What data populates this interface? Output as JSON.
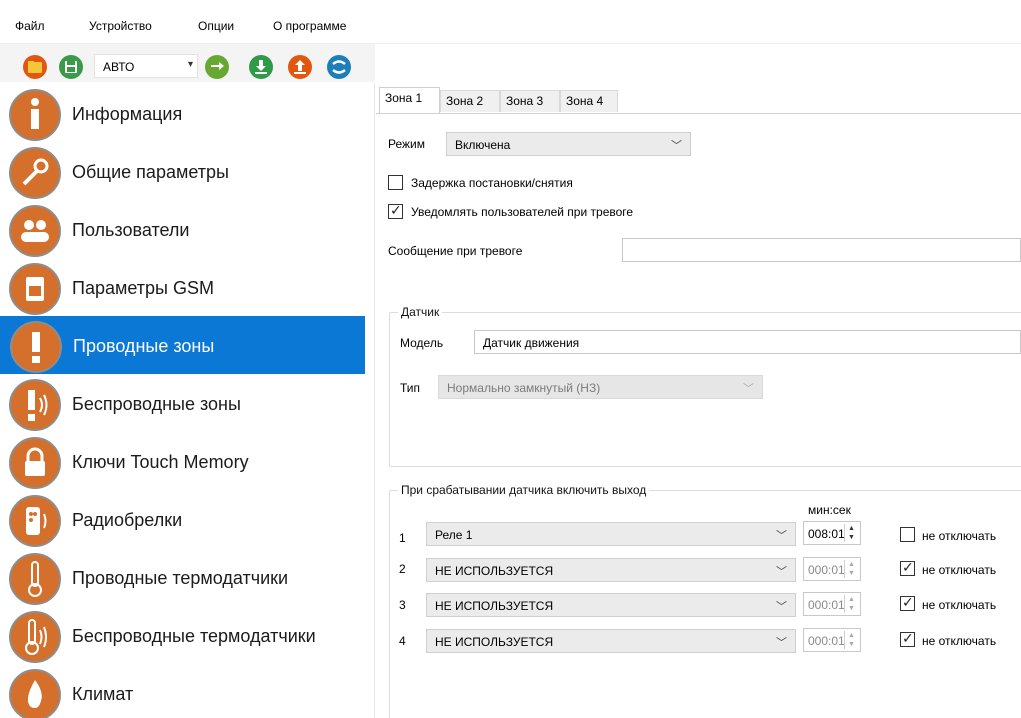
{
  "menu": [
    "Файл",
    "Устройство",
    "Опции",
    "О программе"
  ],
  "toolbar": {
    "mode_value": "АВТО",
    "icons": [
      "open-folder-icon",
      "save-icon",
      "refresh-icon",
      "download-icon",
      "upload-icon",
      "connect-icon"
    ]
  },
  "sidebar": {
    "items": [
      {
        "label": "Информация",
        "icon": "info-icon"
      },
      {
        "label": "Общие параметры",
        "icon": "wrench-icon"
      },
      {
        "label": "Пользователи",
        "icon": "users-icon"
      },
      {
        "label": "Параметры GSM",
        "icon": "sim-card-icon"
      },
      {
        "label": "Проводные зоны",
        "icon": "exclamation-icon"
      },
      {
        "label": "Беспроводные зоны",
        "icon": "wireless-exclamation-icon"
      },
      {
        "label": "Ключи Touch Memory",
        "icon": "lock-icon"
      },
      {
        "label": "Радиобрелки",
        "icon": "keyfob-icon"
      },
      {
        "label": "Проводные термодатчики",
        "icon": "thermometer-icon"
      },
      {
        "label": "Беспроводные термодатчики",
        "icon": "wireless-thermometer-icon"
      },
      {
        "label": "Климат",
        "icon": "flame-icon"
      }
    ],
    "active_index": 4,
    "active_color": "#0a78d4"
  },
  "tabs": [
    "Зона 1",
    "Зона 2",
    "Зона 3",
    "Зона 4"
  ],
  "zone": {
    "mode_label": "Режим",
    "mode_value": "Включена",
    "delay_label": "Задержка постановки/снятия",
    "delay_checked": false,
    "notify_label": "Уведомлять пользователей при тревоге",
    "notify_checked": true,
    "alarm_msg_label": "Сообщение при тревоге",
    "alarm_msg_value": ""
  },
  "sensor": {
    "group_title": "Датчик",
    "model_label": "Модель",
    "model_value": "Датчик движения",
    "type_label": "Тип",
    "type_value": "Нормально замкнутый (НЗ)"
  },
  "outputs": {
    "group_title": "При срабатывании датчика включить выход",
    "time_header": "мин:сек",
    "rows": [
      {
        "num": "1",
        "relay": "Реле 1",
        "time": "008:01",
        "no_off_label": "не отключать",
        "no_off_checked": false,
        "enabled": true
      },
      {
        "num": "2",
        "relay": "НЕ ИСПОЛЬЗУЕТСЯ",
        "time": "000:01",
        "no_off_label": "не отключать",
        "no_off_checked": true,
        "enabled": false
      },
      {
        "num": "3",
        "relay": "НЕ ИСПОЛЬЗУЕТСЯ",
        "time": "000:01",
        "no_off_label": "не отключать",
        "no_off_checked": true,
        "enabled": false
      },
      {
        "num": "4",
        "relay": "НЕ ИСПОЛЬЗУЕТСЯ",
        "time": "000:01",
        "no_off_label": "не отключать",
        "no_off_checked": true,
        "enabled": false
      }
    ]
  }
}
